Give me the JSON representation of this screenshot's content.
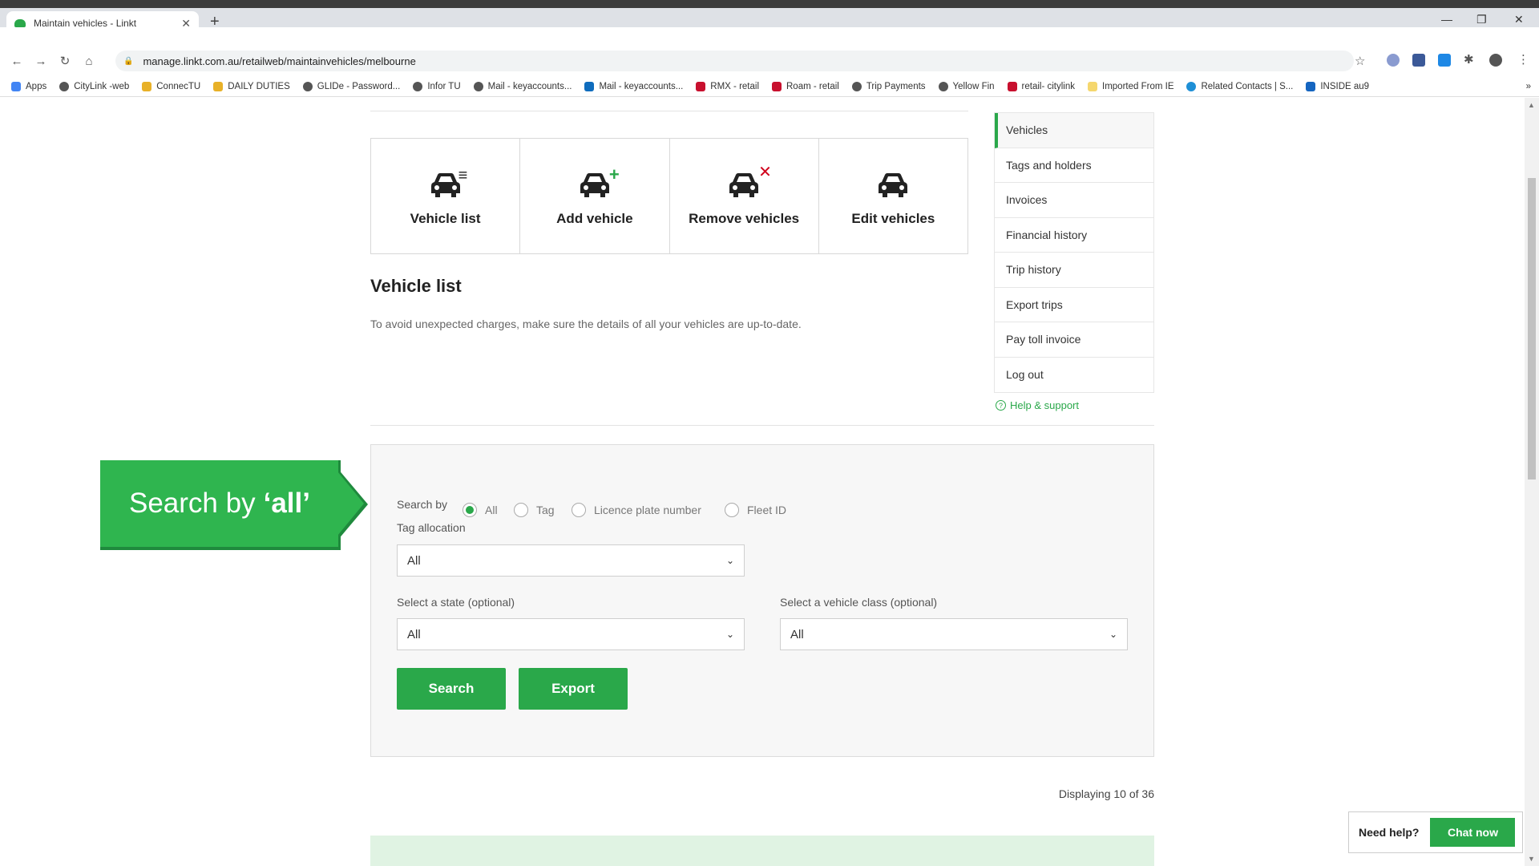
{
  "browser": {
    "tab_title": "Maintain vehicles - Linkt",
    "url": "manage.linkt.com.au/retailweb/maintainvehicles/melbourne",
    "bookmarks": [
      "Apps",
      "CityLink -web",
      "ConnecTU",
      "DAILY DUTIES",
      "GLIDe - Password...",
      "Infor TU",
      "Mail - keyaccounts...",
      "Mail - keyaccounts...",
      "RMX - retail",
      "Roam - retail",
      "Trip Payments",
      "Yellow Fin",
      "retail- citylink",
      "Imported From IE",
      "Related Contacts | S...",
      "INSIDE au9"
    ],
    "more_bookmarks": "»"
  },
  "actions": {
    "vehicle_list": "Vehicle list",
    "add_vehicle": "Add vehicle",
    "remove_vehicles": "Remove vehicles",
    "edit_vehicles": "Edit vehicles"
  },
  "section": {
    "title": "Vehicle list",
    "description": "To avoid unexpected charges, make sure the details of all your vehicles are up-to-date."
  },
  "sidenav": {
    "items": [
      "Vehicles",
      "Tags and holders",
      "Invoices",
      "Financial history",
      "Trip history",
      "Export trips",
      "Pay toll invoice",
      "Log out"
    ],
    "help": "Help & support"
  },
  "search": {
    "search_by_label": "Search by",
    "options": [
      "All",
      "Tag",
      "Licence plate number",
      "Fleet ID"
    ],
    "selected_option": "All",
    "tag_allocation_label": "Tag allocation",
    "tag_allocation_value": "All",
    "state_label": "Select a state (optional)",
    "state_value": "All",
    "class_label": "Select a vehicle class (optional)",
    "class_value": "All",
    "search_button": "Search",
    "export_button": "Export"
  },
  "callout": {
    "prefix": "Search by",
    "emphasis": "‘all’"
  },
  "results": {
    "displaying": "Displaying 10 of 36"
  },
  "chat": {
    "need_help": "Need help?",
    "chat_now": "Chat now"
  },
  "colors": {
    "accent": "#2aa84a",
    "remove_badge": "#d0021b"
  }
}
